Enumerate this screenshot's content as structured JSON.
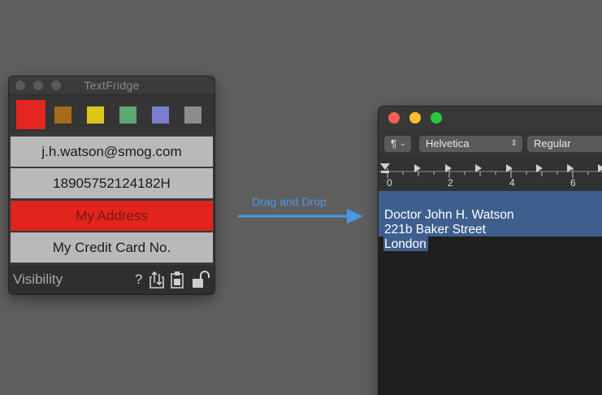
{
  "textfridge": {
    "title": "TextFridge",
    "swatches": [
      "#e52520",
      "#a86a1d",
      "#dcc717",
      "#5ea771",
      "#7b7ed0",
      "#8d8d8d"
    ],
    "rows": [
      {
        "label": "j.h.watson@smog.com",
        "selected": false
      },
      {
        "label": "18905752124182H",
        "selected": false
      },
      {
        "label": "My Address",
        "selected": true
      },
      {
        "label": "My Credit Card No.",
        "selected": false
      }
    ],
    "bottom": {
      "visibility_label": "Visibility",
      "help_glyph": "?",
      "icons": [
        "share-icon",
        "clipboard-icon",
        "unlock-icon"
      ]
    }
  },
  "drag": {
    "label": "Drag and Drop",
    "accent": "#4a97e8"
  },
  "textedit": {
    "toolbar": {
      "paragraph_glyph": "¶",
      "font_family": "Helvetica",
      "font_style": "Regular"
    },
    "ruler": {
      "numbers": [
        "0",
        "2",
        "4",
        "6"
      ]
    },
    "document": {
      "lines": [
        "Doctor John H. Watson",
        "221b Baker Street",
        "London"
      ]
    }
  }
}
